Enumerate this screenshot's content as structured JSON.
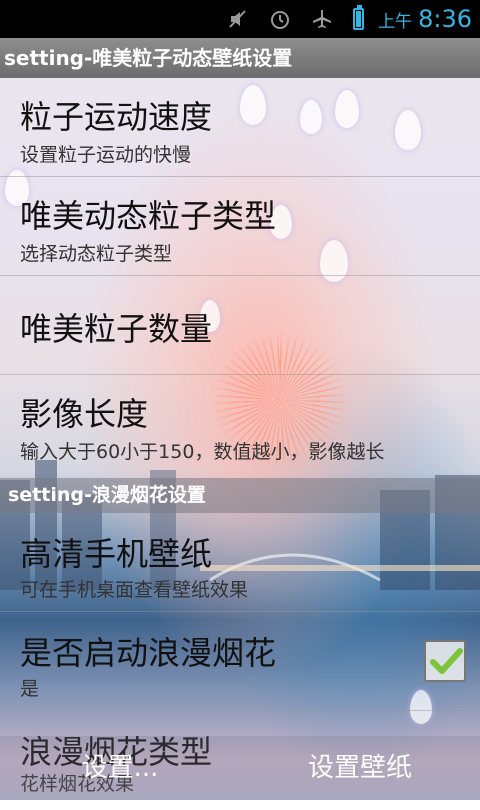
{
  "status_bar": {
    "ampm": "上午",
    "time": "8:36",
    "icons": [
      "mute-icon",
      "alarm-icon",
      "airplane-icon",
      "battery-charging-icon"
    ]
  },
  "app": {
    "title": "setting-唯美粒子动态壁纸设置"
  },
  "preferences_group1": [
    {
      "title": "粒子运动速度",
      "summary": "设置粒子运动的快慢"
    },
    {
      "title": "唯美动态粒子类型",
      "summary": "选择动态粒子类型"
    },
    {
      "title": "唯美粒子数量",
      "summary": ""
    },
    {
      "title": "影像长度",
      "summary": "输入大于60小于150，数值越小，影像越长"
    }
  ],
  "category2": {
    "title": "setting-浪漫烟花设置"
  },
  "preferences_group2": [
    {
      "title": "高清手机壁纸",
      "summary": "可在手机桌面查看壁纸效果"
    },
    {
      "title": "是否启动浪漫烟花",
      "summary": "是",
      "checked": true
    },
    {
      "title": "浪漫烟花类型",
      "summary": "花样烟花效果"
    }
  ],
  "buttons": {
    "settings": "设置...",
    "set_wallpaper": "设置壁纸"
  },
  "colors": {
    "accent": "#33b5e5",
    "check": "#7cc43a"
  }
}
